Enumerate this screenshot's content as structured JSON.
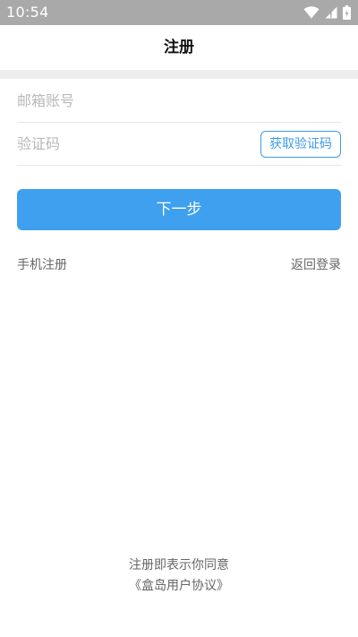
{
  "status_bar": {
    "time": "10:54",
    "icons": [
      "wifi-icon",
      "signal-icon",
      "battery-icon"
    ]
  },
  "header": {
    "title": "注册"
  },
  "form": {
    "email_placeholder": "邮箱账号",
    "code_placeholder": "验证码",
    "get_code_label": "获取验证码",
    "next_label": "下一步"
  },
  "links": {
    "phone_register": "手机注册",
    "back_to_login": "返回登录"
  },
  "footer": {
    "agree_text": "注册即表示你同意",
    "agreement_link": "《盒岛用户协议》"
  },
  "colors": {
    "accent": "#3ea0ef",
    "status_bar": "#a9a9a9",
    "divider": "#ededed",
    "text_secondary": "#666666",
    "placeholder": "#b8b8b8"
  }
}
